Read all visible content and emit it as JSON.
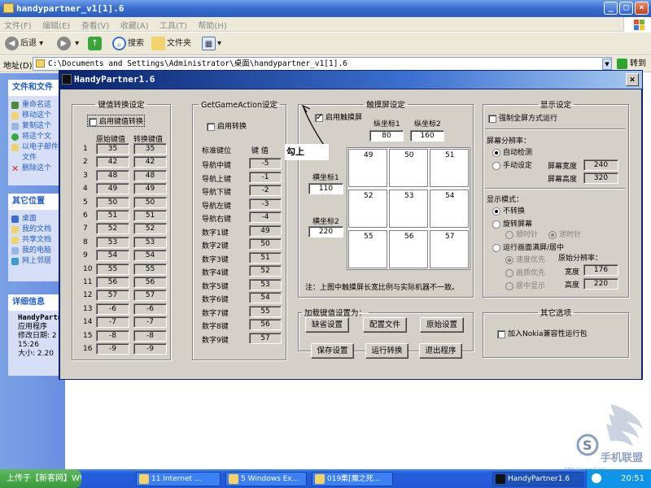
{
  "explorer": {
    "title": "handypartner_v1[1].6",
    "menu": [
      "文件(F)",
      "编辑(E)",
      "查看(V)",
      "收藏(A)",
      "工具(T)",
      "帮助(H)"
    ],
    "toolbar": {
      "back": "后退",
      "search": "搜索",
      "folders": "文件夹"
    },
    "address_label": "地址(D)",
    "address": "C:\\Documents and Settings\\Administrator\\桌面\\handypartner_v1[1].6",
    "go": "转到"
  },
  "left_panel": {
    "tasks": {
      "title": "文件和文件",
      "items": [
        "重命名这",
        "移动这个",
        "复制这个",
        "将这个文",
        "以电子邮件",
        "文件",
        "删除这个"
      ]
    },
    "places": {
      "title": "其它位置",
      "items": [
        "桌面",
        "我的文档",
        "共享文档",
        "我的电脑",
        "网上邻居"
      ]
    },
    "details": {
      "title": "详细信息",
      "lines": [
        "HandyPartn",
        "应用程序",
        "修改日期: 2",
        "15:26",
        "大小: 2.20"
      ]
    }
  },
  "dialog": {
    "title": "HandyPartner1.6",
    "close": "×",
    "key_convert": {
      "legend": "键值转换设定",
      "enable": "启用键值转换",
      "col_orig": "原始键值",
      "col_conv": "转换键值",
      "rows": [
        {
          "n": "1",
          "o": "35",
          "c": "35"
        },
        {
          "n": "2",
          "o": "42",
          "c": "42"
        },
        {
          "n": "3",
          "o": "48",
          "c": "48"
        },
        {
          "n": "4",
          "o": "49",
          "c": "49"
        },
        {
          "n": "5",
          "o": "50",
          "c": "50"
        },
        {
          "n": "6",
          "o": "51",
          "c": "51"
        },
        {
          "n": "7",
          "o": "52",
          "c": "52"
        },
        {
          "n": "8",
          "o": "53",
          "c": "53"
        },
        {
          "n": "9",
          "o": "54",
          "c": "54"
        },
        {
          "n": "10",
          "o": "55",
          "c": "55"
        },
        {
          "n": "11",
          "o": "56",
          "c": "56"
        },
        {
          "n": "12",
          "o": "57",
          "c": "57"
        },
        {
          "n": "13",
          "o": "-6",
          "c": "-6"
        },
        {
          "n": "14",
          "o": "-7",
          "c": "-7"
        },
        {
          "n": "15",
          "o": "-8",
          "c": "-8"
        },
        {
          "n": "16",
          "o": "-9",
          "c": "-9"
        }
      ]
    },
    "game_action": {
      "legend": "GetGameAction设定",
      "enable": "启用转换",
      "col_key": "标准键位",
      "col_val": "键 值",
      "rows": [
        {
          "k": "导航中键",
          "v": "-5"
        },
        {
          "k": "导航上键",
          "v": "-1"
        },
        {
          "k": "导航下键",
          "v": "-2"
        },
        {
          "k": "导航左键",
          "v": "-3"
        },
        {
          "k": "导航右键",
          "v": "-4"
        },
        {
          "k": "数字1键",
          "v": "49"
        },
        {
          "k": "数字2键",
          "v": "50"
        },
        {
          "k": "数字3键",
          "v": "51"
        },
        {
          "k": "数字4键",
          "v": "52"
        },
        {
          "k": "数字5键",
          "v": "53"
        },
        {
          "k": "数字6键",
          "v": "54"
        },
        {
          "k": "数字7键",
          "v": "55"
        },
        {
          "k": "数字8键",
          "v": "56"
        },
        {
          "k": "数字9键",
          "v": "57"
        }
      ]
    },
    "touch": {
      "legend": "触摸屏设定",
      "enable": "启用触摸屏",
      "annotation": "勾上",
      "y1_label": "纵坐标1",
      "y2_label": "纵坐标2",
      "y1": "80",
      "y2": "160",
      "x1_label": "横坐标1",
      "x2_label": "横坐标2",
      "x1": "110",
      "x2": "220",
      "grid": [
        "49",
        "50",
        "51",
        "52",
        "53",
        "54",
        "55",
        "56",
        "57"
      ],
      "note": "注：上图中触摸屏长宽比例与实际机器不一致。"
    },
    "load": {
      "legend": "加载键值设置为：",
      "default": "缺省设置",
      "config": "配置文件",
      "original": "原始设置"
    },
    "actions": {
      "save": "保存设置",
      "run": "运行转换",
      "exit": "退出程序"
    },
    "display": {
      "legend": "显示设定",
      "fullscreen": "强制全屏方式运行",
      "res_title": "屏幕分辨率：",
      "auto": "自动检测",
      "manual": "手动设定",
      "width_label": "屏幕宽度",
      "height_label": "屏幕高度",
      "width": "240",
      "height": "320",
      "mode_title": "显示模式：",
      "no_rotate": "不转换",
      "rotate": "旋转屏幕",
      "cw": "顺时针",
      "ccw": "逆时针",
      "run_full": "运行画面满屏/居中",
      "speed": "速度优先",
      "quality": "画质优先",
      "center": "居中显示",
      "orig_res": "原始分辨率：",
      "ow_label": "宽度",
      "oh_label": "高度",
      "ow": "176",
      "oh": "220"
    },
    "other": {
      "legend": "其它选项",
      "nokia": "加入Nokia兼容性运行包"
    }
  },
  "taskbar": {
    "start": "上传于【新客网】WWW.XKER.COM",
    "tasks": [
      "11 Internet ...",
      "5 Windows Ex...",
      "019集[魔之死...",
      "HandyPartner1.6"
    ],
    "clock": "20:51"
  },
  "watermark": "http://www.sj.org"
}
